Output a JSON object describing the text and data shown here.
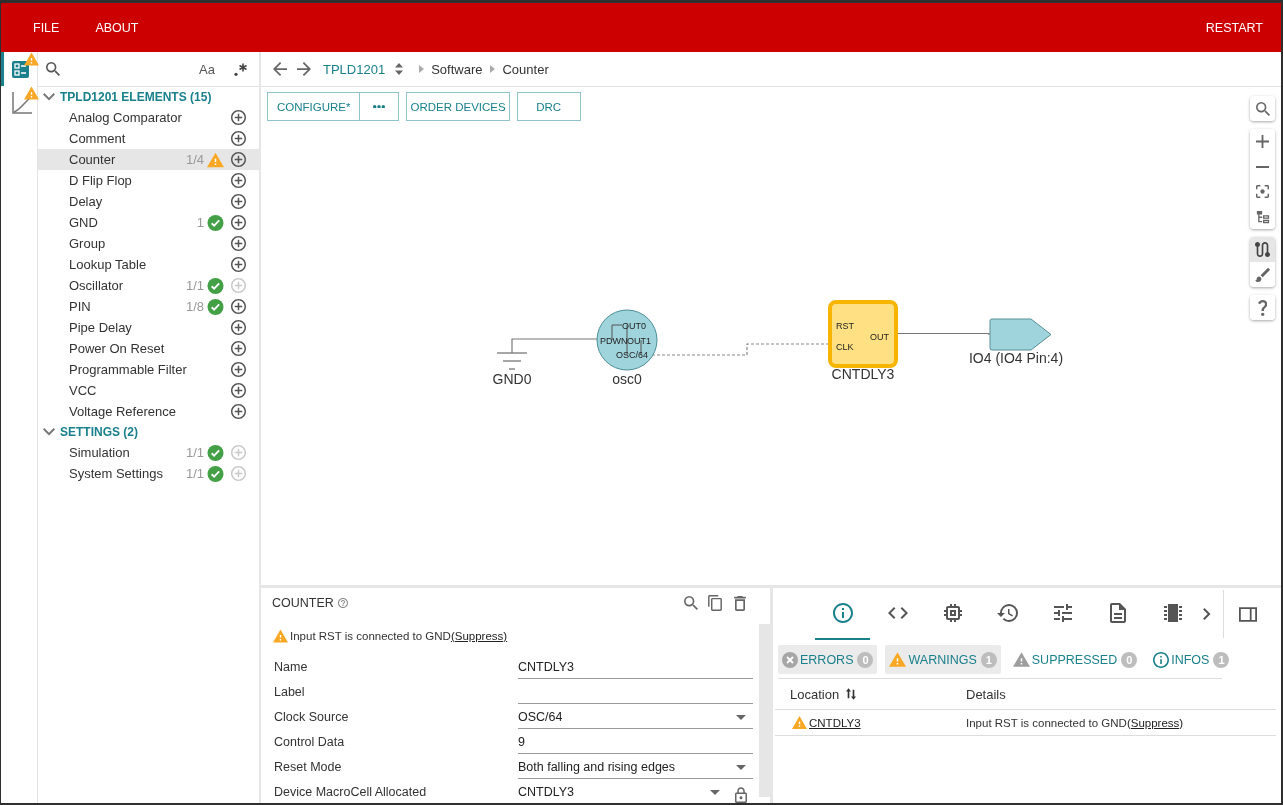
{
  "menu": {
    "left": [
      "FILE",
      "ABOUT"
    ],
    "right": [
      "RESTART"
    ]
  },
  "rail": [
    {
      "selected": true,
      "warning": true
    },
    {
      "selected": false,
      "warning": true
    }
  ],
  "sidebar": {
    "search": {
      "match_case": "Aa"
    },
    "groups": [
      {
        "title": "TPLD1201 ELEMENTS (15)",
        "expanded": true,
        "children": [
          {
            "label": "Analog Comparator",
            "kind": "plain",
            "selected": false,
            "add_enabled": true
          },
          {
            "label": "Comment",
            "kind": "plain",
            "selected": false,
            "add_enabled": true
          },
          {
            "label": "Counter",
            "count": "1/4",
            "kind": "warning",
            "selected": true,
            "add_enabled": true
          },
          {
            "label": "D Flip Flop",
            "kind": "plain",
            "selected": false,
            "add_enabled": true
          },
          {
            "label": "Delay",
            "kind": "plain",
            "selected": false,
            "add_enabled": true
          },
          {
            "label": "GND",
            "count": "1",
            "kind": "ok",
            "selected": false,
            "add_enabled": true
          },
          {
            "label": "Group",
            "kind": "plain",
            "selected": false,
            "add_enabled": true
          },
          {
            "label": "Lookup Table",
            "kind": "plain",
            "selected": false,
            "add_enabled": true
          },
          {
            "label": "Oscillator",
            "count": "1/1",
            "kind": "ok",
            "selected": false,
            "add_enabled": false
          },
          {
            "label": "PIN",
            "count": "1/8",
            "kind": "ok",
            "selected": false,
            "add_enabled": true
          },
          {
            "label": "Pipe Delay",
            "kind": "plain",
            "selected": false,
            "add_enabled": true
          },
          {
            "label": "Power On Reset",
            "kind": "plain",
            "selected": false,
            "add_enabled": true
          },
          {
            "label": "Programmable Filter",
            "kind": "plain",
            "selected": false,
            "add_enabled": true
          },
          {
            "label": "VCC",
            "kind": "plain",
            "selected": false,
            "add_enabled": true
          },
          {
            "label": "Voltage Reference",
            "kind": "plain",
            "selected": false,
            "add_enabled": true
          }
        ]
      },
      {
        "title": "SETTINGS (2)",
        "expanded": true,
        "children": [
          {
            "label": "Simulation",
            "count": "1/1",
            "kind": "ok",
            "selected": false,
            "add_enabled": false
          },
          {
            "label": "System Settings",
            "count": "1/1",
            "kind": "ok",
            "selected": false,
            "add_enabled": false
          }
        ]
      }
    ]
  },
  "breadcrumb": {
    "device": "TPLD1201",
    "path": [
      "Software",
      "Counter"
    ]
  },
  "toolbar": [
    {
      "label": "CONFIGURE*",
      "kind": "split"
    },
    {
      "label": "ORDER DEVICES",
      "kind": "plain"
    },
    {
      "label": "DRC",
      "kind": "plain"
    }
  ],
  "canvas_tools": [
    [
      {
        "selected": false
      }
    ],
    [
      {
        "selected": false
      },
      {
        "selected": false
      },
      {
        "selected": false
      },
      {
        "selected": false
      }
    ],
    [
      {
        "selected": true
      },
      {
        "selected": false
      }
    ],
    [
      {
        "selected": false
      }
    ]
  ],
  "diagram": {
    "nodes": [
      {
        "kind": "ground",
        "label": "GND0",
        "selected": false
      },
      {
        "kind": "oscillator",
        "label": "osc0",
        "pins": [
          "OUT0",
          "PDWN",
          "OUT1",
          "OSC/64"
        ],
        "selected": false
      },
      {
        "kind": "counter",
        "label": "CNTDLY3",
        "pins": [
          "RST",
          "CLK",
          "OUT"
        ],
        "selected": true
      },
      {
        "kind": "io",
        "label": "IO4 (IO4 Pin:4)",
        "selected": false
      }
    ],
    "wires": [
      {
        "dashed": false
      },
      {
        "dashed": true
      },
      {
        "dashed": false
      }
    ]
  },
  "properties": {
    "title": "COUNTER",
    "warning": {
      "text": "Input RST is connected to GND",
      "action": "(Suppress)"
    },
    "fields": [
      {
        "label": "Name",
        "kind": "text",
        "value": "CNTDLY3",
        "locked": false
      },
      {
        "label": "Label",
        "kind": "text",
        "locked": false
      },
      {
        "label": "Clock Source",
        "kind": "select",
        "value": "OSC/64",
        "locked": false
      },
      {
        "label": "Control Data",
        "kind": "text",
        "value": "9",
        "locked": false
      },
      {
        "label": "Reset Mode",
        "kind": "select",
        "value": "Both falling and rising edges",
        "locked": false
      },
      {
        "label": "Device MacroCell Allocated",
        "kind": "select",
        "value": "CNTDLY3",
        "locked": true
      }
    ]
  },
  "issues": {
    "tabs": [
      {
        "selected": true
      },
      {
        "selected": false
      },
      {
        "selected": false
      },
      {
        "selected": false
      },
      {
        "selected": false
      },
      {
        "selected": false
      },
      {
        "selected": false
      }
    ],
    "filters": [
      {
        "kind": "error",
        "label": "ERRORS",
        "count": "0",
        "selected": true
      },
      {
        "kind": "warning",
        "label": "WARNINGS",
        "count": "1",
        "selected": true
      },
      {
        "kind": "suppressed",
        "label": "SUPPRESSED",
        "count": "0",
        "selected": false
      },
      {
        "kind": "info",
        "label": "INFOS",
        "count": "1",
        "selected": false
      }
    ],
    "table": {
      "columns": [
        "Location",
        "Details"
      ],
      "rows": [
        {
          "kind": "warning",
          "location": "CNTDLY3",
          "details": "Input RST is connected to GND",
          "action": "(Suppress)"
        }
      ]
    }
  }
}
